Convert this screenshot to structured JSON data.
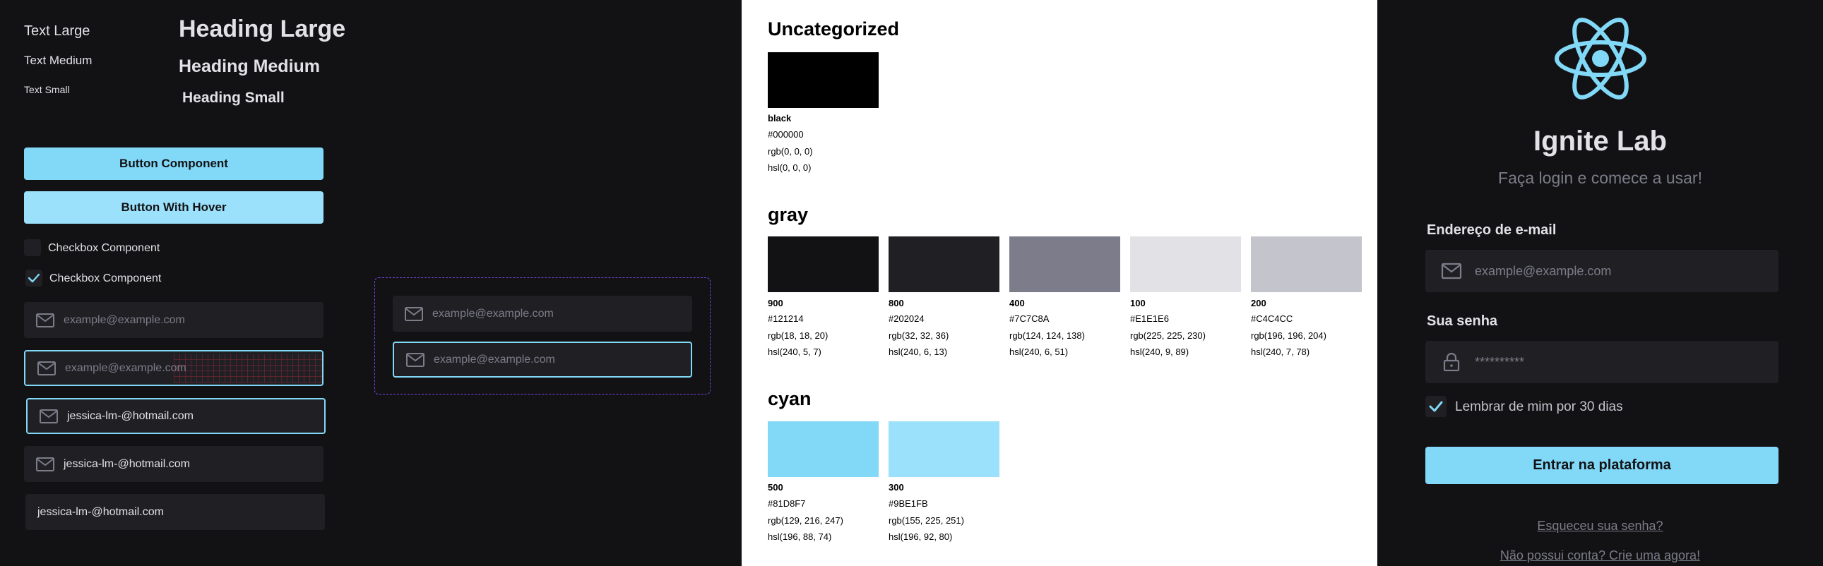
{
  "left": {
    "text_sizes": {
      "large": "Text Large",
      "medium": "Text Medium",
      "small": "Text Small"
    },
    "headings": {
      "large": "Heading Large",
      "medium": "Heading Medium",
      "small": "Heading Small"
    },
    "buttons": {
      "primary": "Button Component",
      "hover": "Button With Hover"
    },
    "checkboxes": {
      "unchecked": "Checkbox Component",
      "checked": "Checkbox Component"
    },
    "inputs": {
      "placeholder": "example@example.com",
      "filled_value": "jessica-lm-@hotmail.com"
    },
    "icons": {
      "field": "envelope-icon",
      "check": "check-icon"
    }
  },
  "palette": {
    "sections": [
      {
        "title": "Uncategorized",
        "colors": [
          {
            "name": "black",
            "hex": "#000000",
            "rgb": "rgb(0, 0, 0)",
            "hsl": "hsl(0, 0, 0)"
          }
        ]
      },
      {
        "title": "gray",
        "colors": [
          {
            "name": "900",
            "hex": "#121214",
            "rgb": "rgb(18, 18, 20)",
            "hsl": "hsl(240, 5, 7)"
          },
          {
            "name": "800",
            "hex": "#202024",
            "rgb": "rgb(32, 32, 36)",
            "hsl": "hsl(240, 6, 13)"
          },
          {
            "name": "400",
            "hex": "#7C7C8A",
            "rgb": "rgb(124, 124, 138)",
            "hsl": "hsl(240, 6, 51)"
          },
          {
            "name": "100",
            "hex": "#E1E1E6",
            "rgb": "rgb(225, 225, 230)",
            "hsl": "hsl(240, 9, 89)"
          },
          {
            "name": "200",
            "hex": "#C4C4CC",
            "rgb": "rgb(196, 196, 204)",
            "hsl": "hsl(240, 7, 78)"
          }
        ]
      },
      {
        "title": "cyan",
        "colors": [
          {
            "name": "500",
            "hex": "#81D8F7",
            "rgb": "rgb(129, 216, 247)",
            "hsl": "hsl(196, 88, 74)"
          },
          {
            "name": "300",
            "hex": "#9BE1FB",
            "rgb": "rgb(155, 225, 251)",
            "hsl": "hsl(196, 92, 80)"
          }
        ]
      }
    ]
  },
  "login": {
    "logo_icon": "react-atom-icon",
    "title": "Ignite Lab",
    "subtitle": "Faça login e comece a usar!",
    "email_label": "Endereço de e-mail",
    "email_placeholder": "example@example.com",
    "password_label": "Sua senha",
    "password_placeholder": "**********",
    "remember_label": "Lembrar de mim por 30 dias",
    "remember_checked": true,
    "submit_label": "Entrar na plataforma",
    "forgot_link": "Esqueceu sua senha?",
    "signup_link": "Não possui conta? Crie uma agora!",
    "icons": {
      "email": "envelope-icon",
      "password": "lock-icon",
      "check": "check-icon"
    }
  },
  "colors": {
    "gray_900": "#121214",
    "gray_800": "#202024",
    "gray_400": "#7C7C8A",
    "gray_100": "#E1E1E6",
    "cyan_500": "#81D8F7",
    "cyan_300": "#9BE1FB",
    "dashed_outline": "#7B45E0"
  }
}
